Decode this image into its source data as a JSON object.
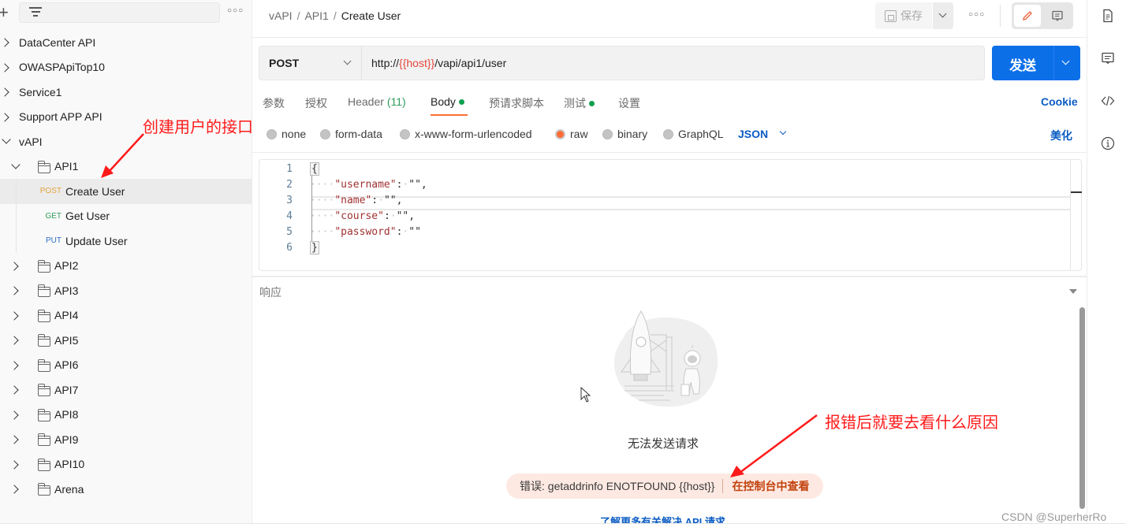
{
  "sidebar": {
    "add_icon": "plus-icon",
    "filter_icon": "filter-icon",
    "more_icon": "more-horizontal-icon",
    "collections": [
      {
        "label": "DataCenter API",
        "expanded": false
      },
      {
        "label": "OWASPApiTop10",
        "expanded": false
      },
      {
        "label": "Service1",
        "expanded": false
      },
      {
        "label": "Support APP API",
        "expanded": false
      },
      {
        "label": "vAPI",
        "expanded": true
      }
    ],
    "api1_folder": {
      "label": "API1",
      "expanded": true
    },
    "requests": [
      {
        "method": "POST",
        "label": "Create User",
        "active": true
      },
      {
        "method": "GET",
        "label": "Get User",
        "active": false
      },
      {
        "method": "PUT",
        "label": "Update User",
        "active": false
      }
    ],
    "folders": [
      "API2",
      "API3",
      "API4",
      "API5",
      "API6",
      "API7",
      "API8",
      "API9",
      "API10",
      "Arena"
    ]
  },
  "annotations": {
    "create_user_note": "创建用户的接口",
    "error_note": "报错后就要去看什么原因",
    "color": "#ff1a1a"
  },
  "header": {
    "breadcrumb": [
      "vAPI",
      "API1",
      "Create User"
    ],
    "save_label": "保存",
    "more_icon": "more-horizontal-icon",
    "edit_icon": "pencil-icon",
    "comment_icon": "comment-icon"
  },
  "rail": {
    "icons": [
      "document-icon",
      "comment-icon",
      "code-icon",
      "info-icon"
    ]
  },
  "request": {
    "method": "POST",
    "url_prefix": "http://",
    "url_variable": "{{host}}",
    "url_suffix": "/vapi/api1/user",
    "send_label": "发送",
    "send_color": "#0b6fe8"
  },
  "tabs": [
    {
      "label": "参数",
      "active": false
    },
    {
      "label": "授权",
      "active": false
    },
    {
      "label": "Header",
      "count": "(11)",
      "active": false
    },
    {
      "label": "Body",
      "dot": true,
      "active": true
    },
    {
      "label": "预请求脚本",
      "active": false
    },
    {
      "label": "测试",
      "dot": true,
      "active": false
    },
    {
      "label": "设置",
      "active": false
    }
  ],
  "cookie_label": "Cookie",
  "body_types": [
    {
      "label": "none",
      "selected": false
    },
    {
      "label": "form-data",
      "selected": false
    },
    {
      "label": "x-www-form-urlencoded",
      "selected": false
    },
    {
      "label": "raw",
      "selected": true
    },
    {
      "label": "binary",
      "selected": false
    },
    {
      "label": "GraphQL",
      "selected": false
    }
  ],
  "raw_language": "JSON",
  "beautify_label": "美化",
  "editor": {
    "line_numbers": [
      "1",
      "2",
      "3",
      "4",
      "5",
      "6"
    ],
    "lines": [
      {
        "open": "{"
      },
      {
        "key": "\"username\"",
        "value": "\"\"",
        "trail": ","
      },
      {
        "key": "\"name\"",
        "value": "\"\"",
        "trail": ","
      },
      {
        "key": "\"course\"",
        "value": "\"\"",
        "trail": ","
      },
      {
        "key": "\"password\"",
        "value": "\"\"",
        "trail": ""
      },
      {
        "close": "}"
      }
    ]
  },
  "response": {
    "title": "响应",
    "empty_message": "无法发送请求",
    "error_label": "错误: getaddrinfo ENOTFOUND {{host}}",
    "console_link": "在控制台中查看",
    "learn_more": "了解更多有关解决 API 请求"
  },
  "watermark": "CSDN @SuperherRo"
}
